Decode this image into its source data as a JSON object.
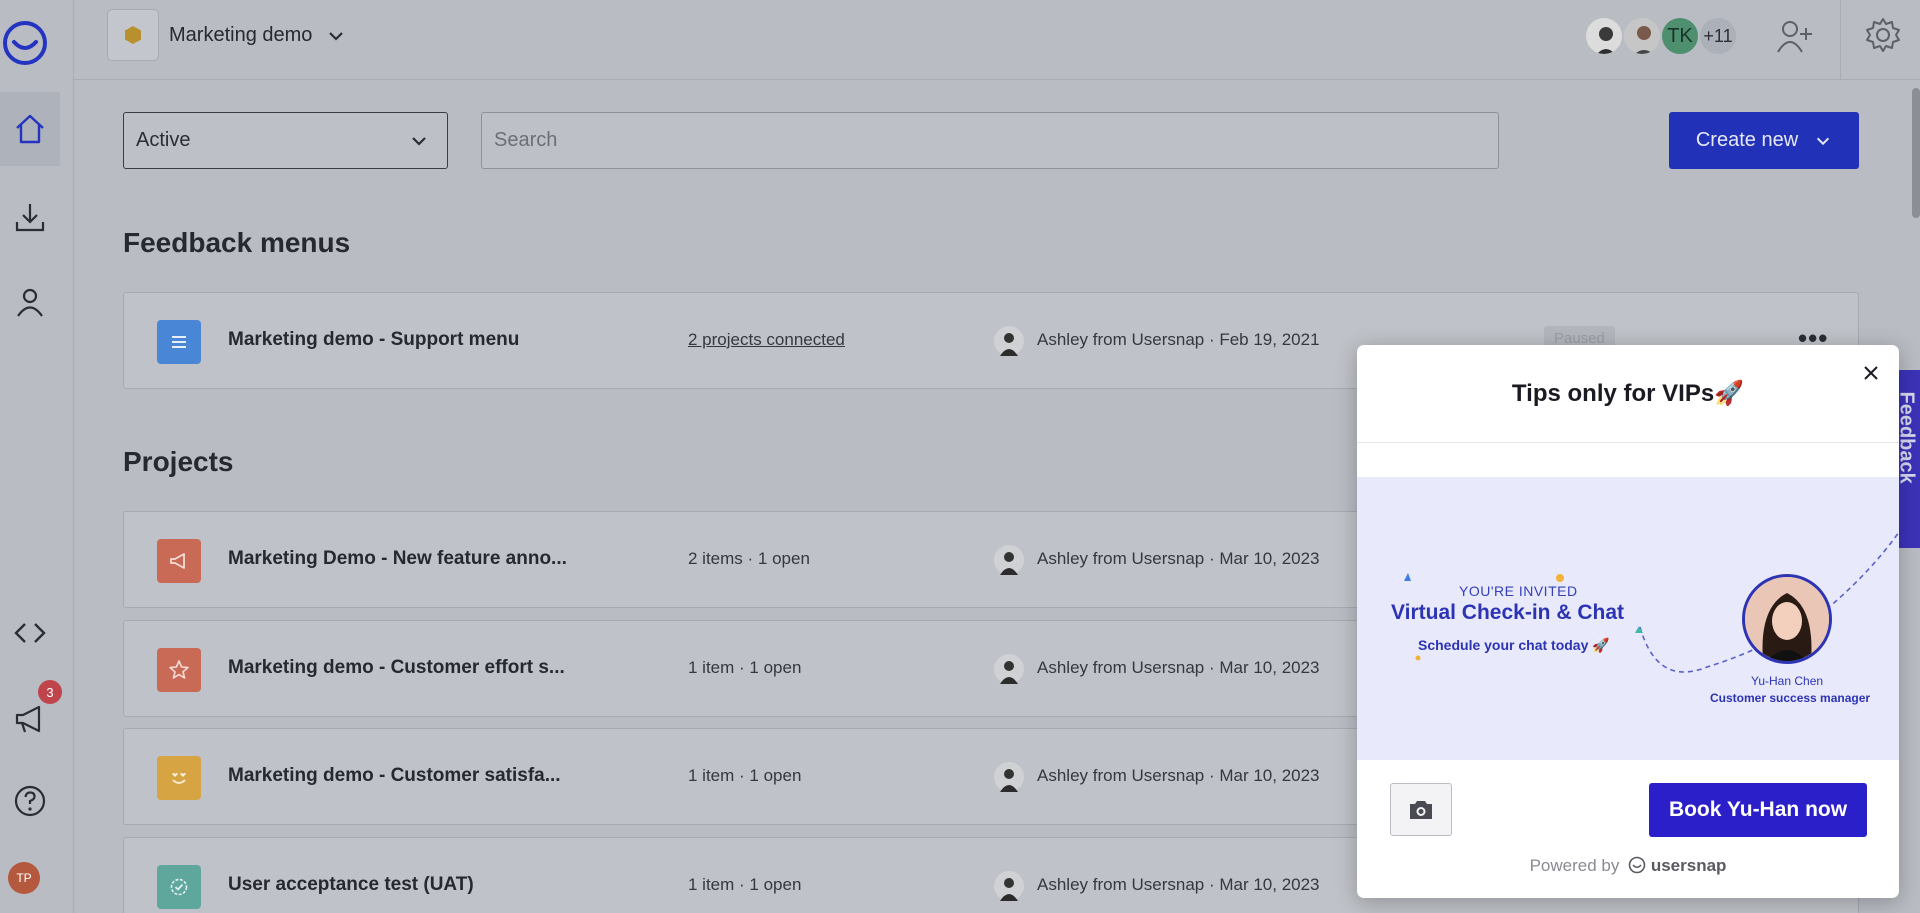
{
  "workspace": {
    "name": "Marketing demo"
  },
  "header": {
    "member_initials": "TK",
    "member_more": "+11"
  },
  "sidebar": {
    "notification_count": "3",
    "user_initials": "TP"
  },
  "filters": {
    "status_value": "Active",
    "search_placeholder": "Search",
    "create_label": "Create new"
  },
  "feedback_menus": {
    "title": "Feedback menus",
    "rows": [
      {
        "name": "Marketing demo - Support menu",
        "meta": "2 projects connected",
        "owner": "Ashley from Usersnap · Feb 19, 2021",
        "status": "Paused",
        "color": "#4a86d6"
      }
    ]
  },
  "projects": {
    "title": "Projects",
    "rows": [
      {
        "name": "Marketing Demo - New feature anno...",
        "meta": "2 items · 1 open",
        "owner": "Ashley from Usersnap · Mar 10, 2023",
        "color": "#c96a57"
      },
      {
        "name": "Marketing demo - Customer effort s...",
        "meta": "1 item · 1 open",
        "owner": "Ashley from Usersnap · Mar 10, 2023",
        "color": "#c96a57"
      },
      {
        "name": "Marketing demo - Customer satisfa...",
        "meta": "1 item · 1 open",
        "owner": "Ashley from Usersnap · Mar 10, 2023",
        "color": "#d7a443"
      },
      {
        "name": "User acceptance test (UAT)",
        "meta": "1 item · 1 open",
        "owner": "Ashley from Usersnap · Mar 10, 2023",
        "color": "#5fa79c"
      }
    ]
  },
  "feedback_tab": {
    "label": "Feedback"
  },
  "widget": {
    "title": "Tips only for VIPs🚀",
    "banner": {
      "invited": "YOU'RE INVITED",
      "headline": "Virtual Check-in & Chat",
      "sub": "Schedule your chat today 🚀",
      "person_name": "Yu-Han Chen",
      "person_role": "Customer success manager"
    },
    "cta_label": "Book Yu-Han now",
    "powered_prefix": "Powered by",
    "powered_brand": "usersnap"
  }
}
